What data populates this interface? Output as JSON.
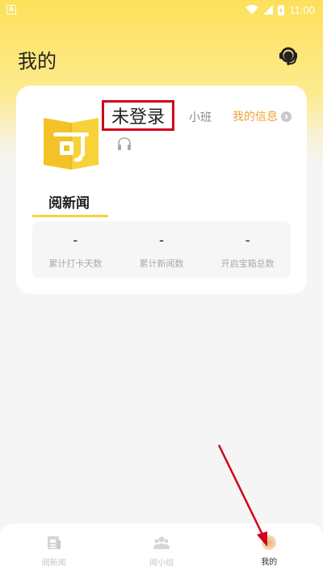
{
  "status_bar": {
    "notification_glyph": "A",
    "time": "11:00"
  },
  "header": {
    "title": "我的",
    "service_icon": "customer-service-icon"
  },
  "profile": {
    "username": "未登录",
    "class_label": "小班",
    "my_info_label": "我的信息",
    "tab_label": "阅新闻",
    "stats": [
      {
        "value": "-",
        "label": "累计打卡天数"
      },
      {
        "value": "-",
        "label": "累计新闻数"
      },
      {
        "value": "-",
        "label": "开启宝箱总数"
      }
    ]
  },
  "bottom_nav": {
    "items": [
      {
        "label": "阅新闻",
        "icon": "newspaper-icon",
        "active": false
      },
      {
        "label": "阅小组",
        "icon": "group-icon",
        "active": false
      },
      {
        "label": "我的",
        "icon": "profile-icon",
        "active": true
      }
    ]
  },
  "colors": {
    "brand_yellow": "#fde05a",
    "accent_orange": "#f0a43a",
    "annotation_red": "#d0021b"
  }
}
